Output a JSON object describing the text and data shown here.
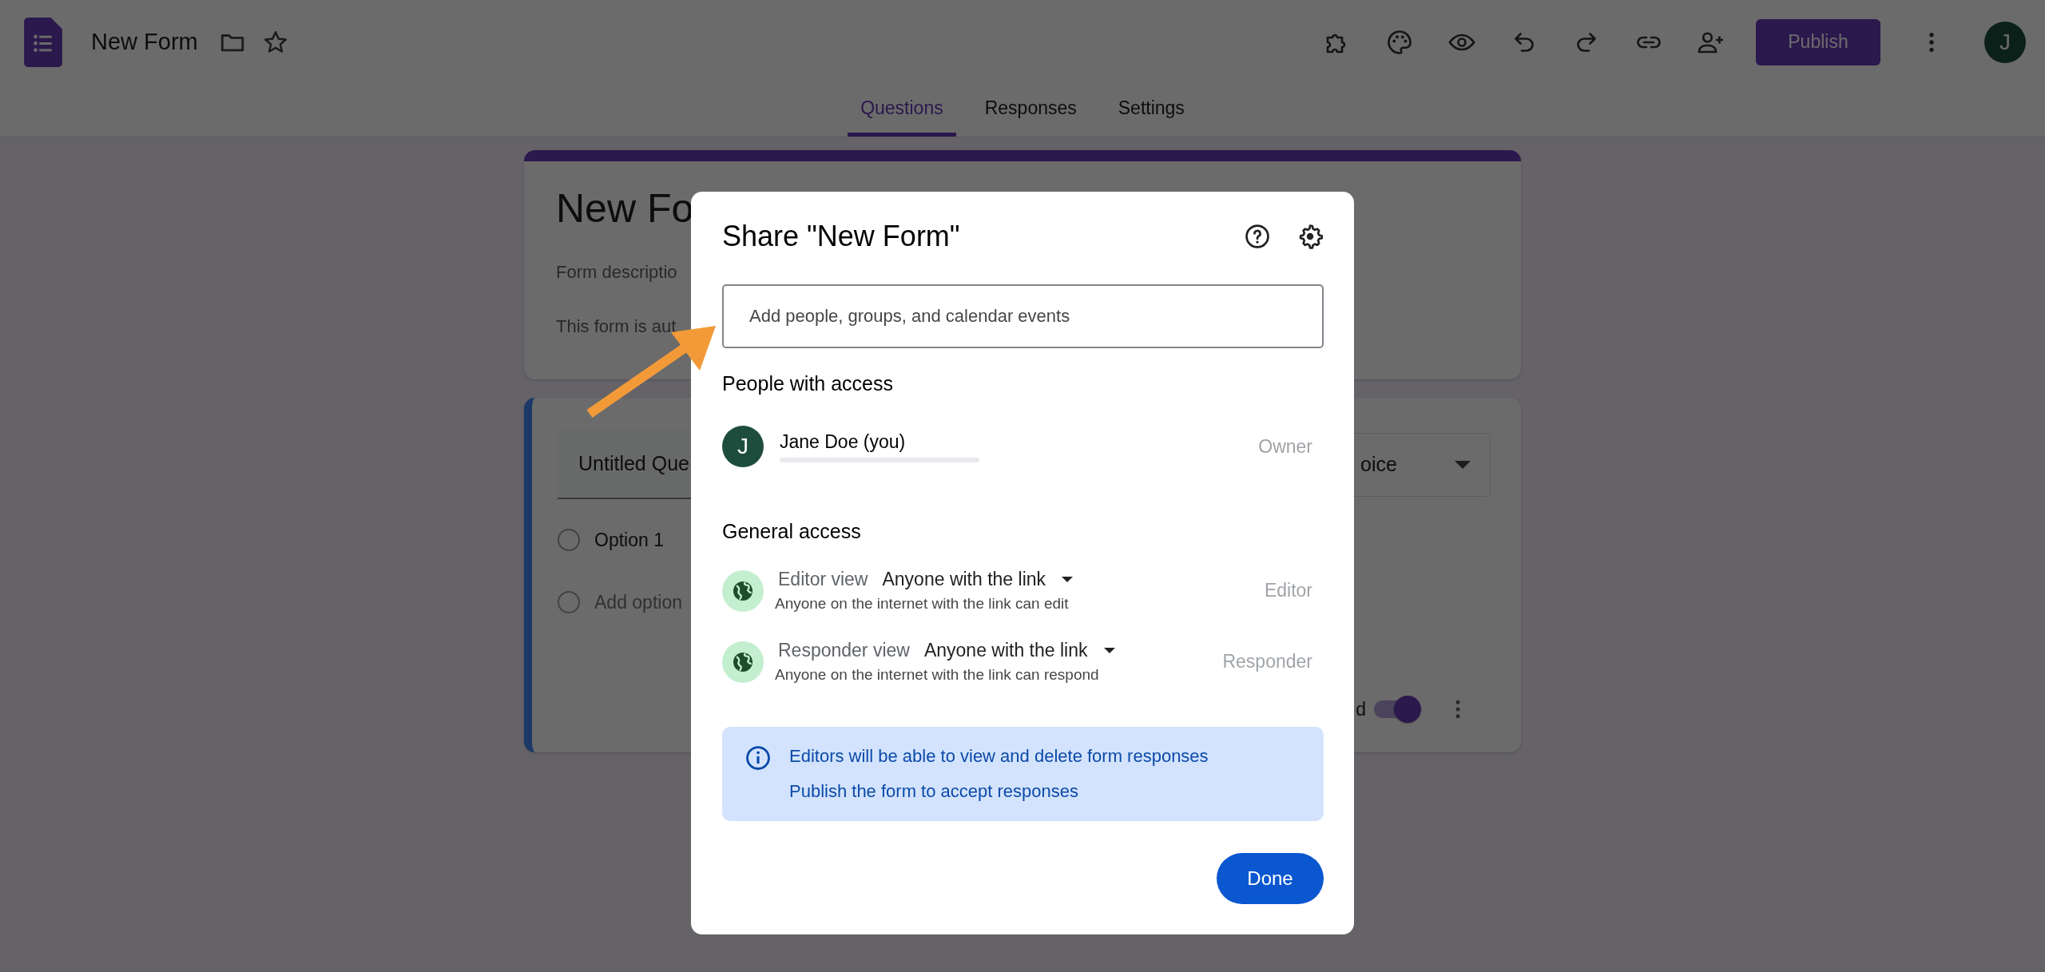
{
  "app": {
    "title": "New Form",
    "publish_button": "Publish",
    "avatar": "J"
  },
  "tabs": [
    {
      "label": "Questions",
      "selected": true
    },
    {
      "label": "Responses",
      "selected": false
    },
    {
      "label": "Settings",
      "selected": false
    }
  ],
  "form": {
    "title": "New Fo",
    "description": "Form descriptio",
    "notice": "This form is aut"
  },
  "question": {
    "title": "Untitled Que",
    "type": "oice",
    "required_label": "d",
    "required": true,
    "options": [
      {
        "kind": "option",
        "label": "Option 1",
        "selected": false
      },
      {
        "kind": "add",
        "label": "Add option",
        "selected": false
      }
    ]
  },
  "dialog": {
    "title": "Share \"New Form\"",
    "input": {
      "placeholder": "Add people, groups, and calendar events"
    },
    "people_heading": "People with access",
    "people": [
      {
        "initial": "J",
        "name": "Jane Doe (you)",
        "role": "Owner"
      }
    ],
    "general_heading": "General access",
    "access": [
      {
        "label": "Editor view",
        "value": "Anyone with the link",
        "description": "Anyone on the internet with the link can edit",
        "role": "Editor"
      },
      {
        "label": "Responder view",
        "value": "Anyone with the link",
        "description": "Anyone on the internet with the link can respond",
        "role": "Responder"
      }
    ],
    "notices": [
      "Editors will be able to view and delete form responses",
      "Publish the form to accept responses"
    ],
    "done_button": "Done"
  }
}
